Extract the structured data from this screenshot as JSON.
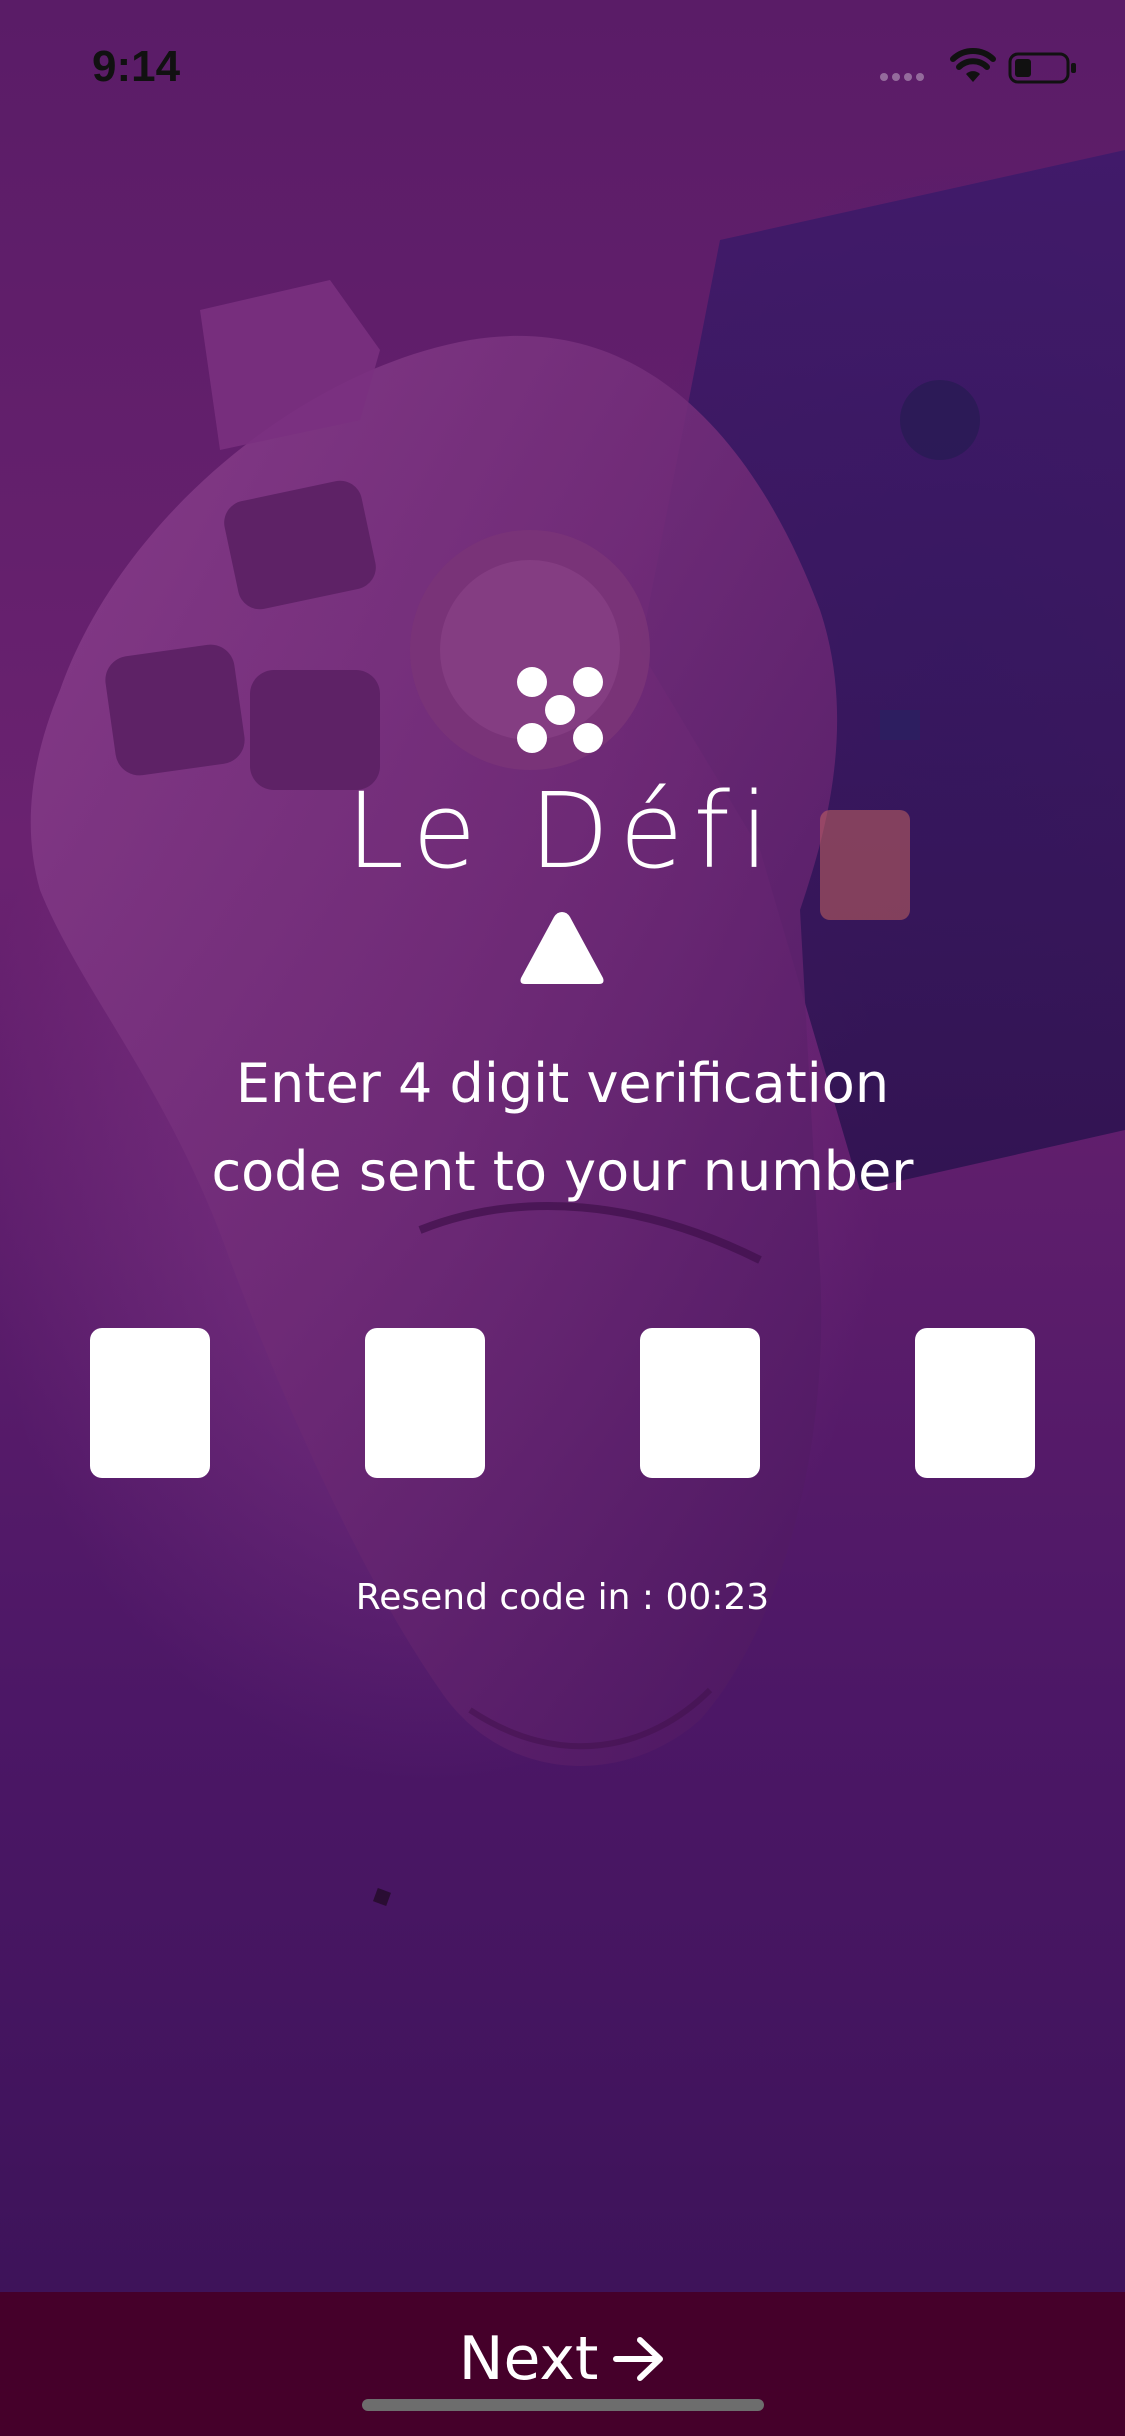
{
  "status_bar": {
    "time": "9:14",
    "icons": [
      "signal-icon",
      "wifi-icon",
      "battery-icon"
    ]
  },
  "brand": {
    "name": "Le Défi",
    "colors": {
      "accent": "#45002a",
      "background": "#5a1c67"
    }
  },
  "heading": {
    "line1": "Enter 4 digit verification",
    "line2": "code sent to your number"
  },
  "code_inputs": {
    "count": 4,
    "values": [
      "",
      "",
      "",
      ""
    ]
  },
  "resend": {
    "label": "Resend code in : ",
    "timer": "00:23"
  },
  "footer": {
    "next_label": "Next",
    "next_icon": "arrow-right-icon"
  }
}
